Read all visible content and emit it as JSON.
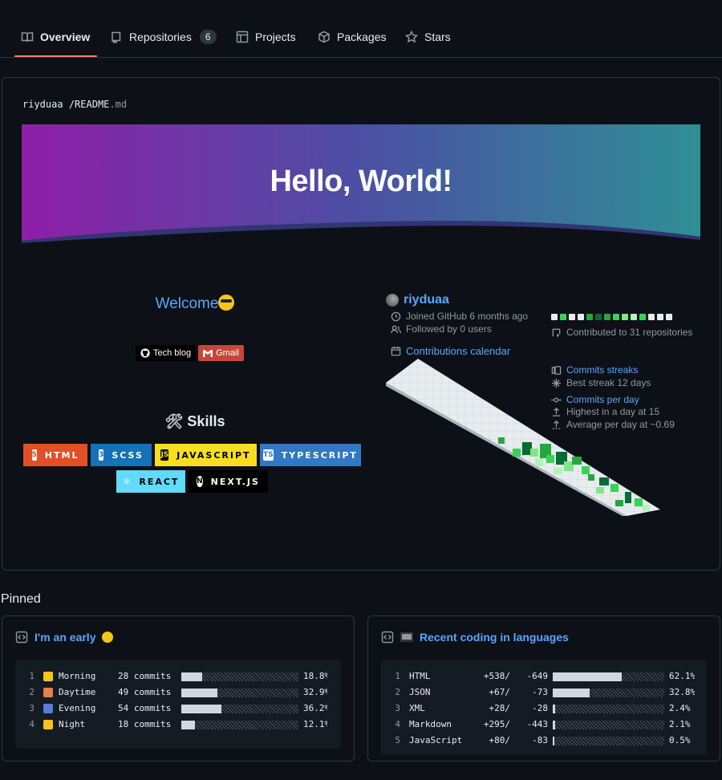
{
  "tabs": [
    {
      "label": "Overview"
    },
    {
      "label": "Repositories",
      "count": "6"
    },
    {
      "label": "Projects"
    },
    {
      "label": "Packages"
    },
    {
      "label": "Stars"
    }
  ],
  "readme": {
    "user": "riyduaa",
    "separator": "/",
    "file": "README",
    "ext": ".md",
    "banner_title": "Hello, World!",
    "welcome": "Welcome",
    "badges": [
      {
        "label": "Tech blog",
        "icon": "github-icon",
        "color": "#000000"
      },
      {
        "label": "Gmail",
        "icon": "gmail-icon",
        "color": "#c5473a"
      }
    ],
    "skills_title": "Skills",
    "skills": [
      {
        "label": "HTML",
        "icon": "html5-icon",
        "bg": "#e34f26",
        "fg": "#ffffff"
      },
      {
        "label": "SCSS",
        "icon": "css3-icon",
        "bg": "#1572b6",
        "fg": "#ffffff"
      },
      {
        "label": "JAVASCRIPT",
        "icon": "js-icon",
        "bg": "#f7df1e",
        "fg": "#000000"
      },
      {
        "label": "TYPESCRIPT",
        "icon": "ts-icon",
        "bg": "#3178c6",
        "fg": "#ffffff"
      },
      {
        "label": "REACT",
        "icon": "react-icon",
        "bg": "#61dafb",
        "fg": "#000000"
      },
      {
        "label": "NEXT.JS",
        "icon": "nextjs-icon",
        "bg": "#000000",
        "fg": "#ffffff"
      }
    ]
  },
  "metrics": {
    "username": "riyduaa",
    "joined": "Joined GitHub 6 months ago",
    "followed": "Followed by 0 users",
    "contributed": "Contributed to 31 repositories",
    "calendar_label": "Contributions calendar",
    "streaks_label": "Commits streaks",
    "best_streak": "Best streak 12 days",
    "per_day_label": "Commits per day",
    "highest": "Highest in a day at 15",
    "average": "Average per day at ~0.69",
    "recent_squares": [
      "#e6edf3",
      "#39d353",
      "#e6edf3",
      "#e6edf3",
      "#26a641",
      "#006d32",
      "#26a641",
      "#39d353",
      "#7ee787",
      "#aff5b4",
      "#39d353",
      "#e6edf3",
      "#e6edf3",
      "#e6edf3"
    ]
  },
  "pinned": {
    "title": "Pinned",
    "cards": [
      {
        "title": "I'm an early",
        "rows": [
          {
            "n": "1",
            "name": "Morning",
            "commits": "28 commits",
            "pct": "18.8%",
            "fraction": 0.188,
            "emoji_color": "#f5c518"
          },
          {
            "n": "2",
            "name": "Daytime",
            "commits": "49 commits",
            "pct": "32.9%",
            "fraction": 0.329,
            "emoji_color": "#e8804a"
          },
          {
            "n": "3",
            "name": "Evening",
            "commits": "54 commits",
            "pct": "36.2%",
            "fraction": 0.362,
            "emoji_color": "#5a7bd6"
          },
          {
            "n": "4",
            "name": "Night",
            "commits": "18 commits",
            "pct": "12.1%",
            "fraction": 0.121,
            "emoji_color": "#f5c518"
          }
        ]
      },
      {
        "title": "Recent coding in languages",
        "rows": [
          {
            "n": "1",
            "name": "HTML",
            "add": "+538/",
            "del": "-649",
            "pct": "62.1%",
            "fraction": 0.621
          },
          {
            "n": "2",
            "name": "JSON",
            "add": "+67/",
            "del": "-73",
            "pct": "32.8%",
            "fraction": 0.328
          },
          {
            "n": "3",
            "name": "XML",
            "add": "+28/",
            "del": "-28",
            "pct": "2.4%",
            "fraction": 0.024
          },
          {
            "n": "4",
            "name": "Markdown",
            "add": "+295/",
            "del": "-443",
            "pct": "2.1%",
            "fraction": 0.021
          },
          {
            "n": "5",
            "name": "JavaScript",
            "add": "+80/",
            "del": "-83",
            "pct": "0.5%",
            "fraction": 0.005
          }
        ]
      }
    ]
  }
}
